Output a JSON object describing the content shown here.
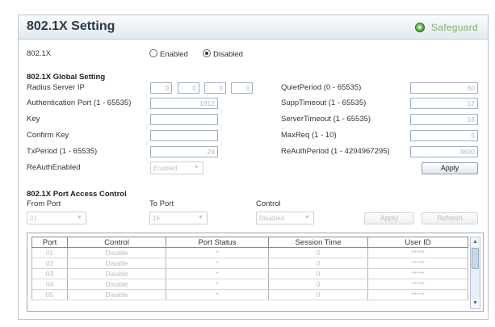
{
  "title": "802.1X Setting",
  "safeguard_label": "Safeguard",
  "mode": {
    "label": "802.1X",
    "enabled_label": "Enabled",
    "disabled_label": "Disabled",
    "selected": "Disabled"
  },
  "global": {
    "heading": "802.1X Global Setting",
    "radius_server_ip_label": "Radius Server IP",
    "radius_ip": [
      "0",
      "0",
      "0",
      "0"
    ],
    "auth_port_label": "Authentication Port (1 - 65535)",
    "auth_port_value": "1812",
    "key_label": "Key",
    "key_value": "",
    "confirm_key_label": "Confirm Key",
    "confirm_key_value": "",
    "txperiod_label": "TxPeriod (1 - 65535)",
    "txperiod_value": "24",
    "reauth_enabled_label": "ReAuthEnabled",
    "reauth_enabled_value": "Enabled",
    "quiet_period_label": "QuietPeriod (0 - 65535)",
    "quiet_period_value": "60",
    "supp_timeout_label": "SuppTimeout (1 - 65535)",
    "supp_timeout_value": "12",
    "server_timeout_label": "ServerTimeout (1 - 65535)",
    "server_timeout_value": "16",
    "maxreq_label": "MaxReq (1 - 10)",
    "maxreq_value": "5",
    "reauth_period_label": "ReAuthPeriod (1 - 4294967295)",
    "reauth_period_value": "3600",
    "apply_label": "Apply"
  },
  "port_access": {
    "heading": "802.1X Port Access Control",
    "from_port_label": "From Port",
    "from_port_value": "01",
    "to_port_label": "To Port",
    "to_port_value": "16",
    "control_label": "Control",
    "control_value": "Disabled",
    "apply_label": "Apply",
    "refresh_label": "Refresh"
  },
  "table": {
    "columns": [
      "Port",
      "Control",
      "Port Status",
      "Session Time",
      "User ID"
    ],
    "rows": [
      [
        "01",
        "Disable",
        "*",
        "0",
        "*****"
      ],
      [
        "02",
        "Disable",
        "*",
        "0",
        "*****"
      ],
      [
        "03",
        "Disable",
        "*",
        "0",
        "*****"
      ],
      [
        "04",
        "Disable",
        "*",
        "0",
        "*****"
      ],
      [
        "05",
        "Disable",
        "*",
        "0",
        "*****"
      ]
    ]
  },
  "colors": {
    "title_text": "#2a3a4a",
    "safeguard_text": "#7fb069",
    "border": "#b9c2cc"
  }
}
